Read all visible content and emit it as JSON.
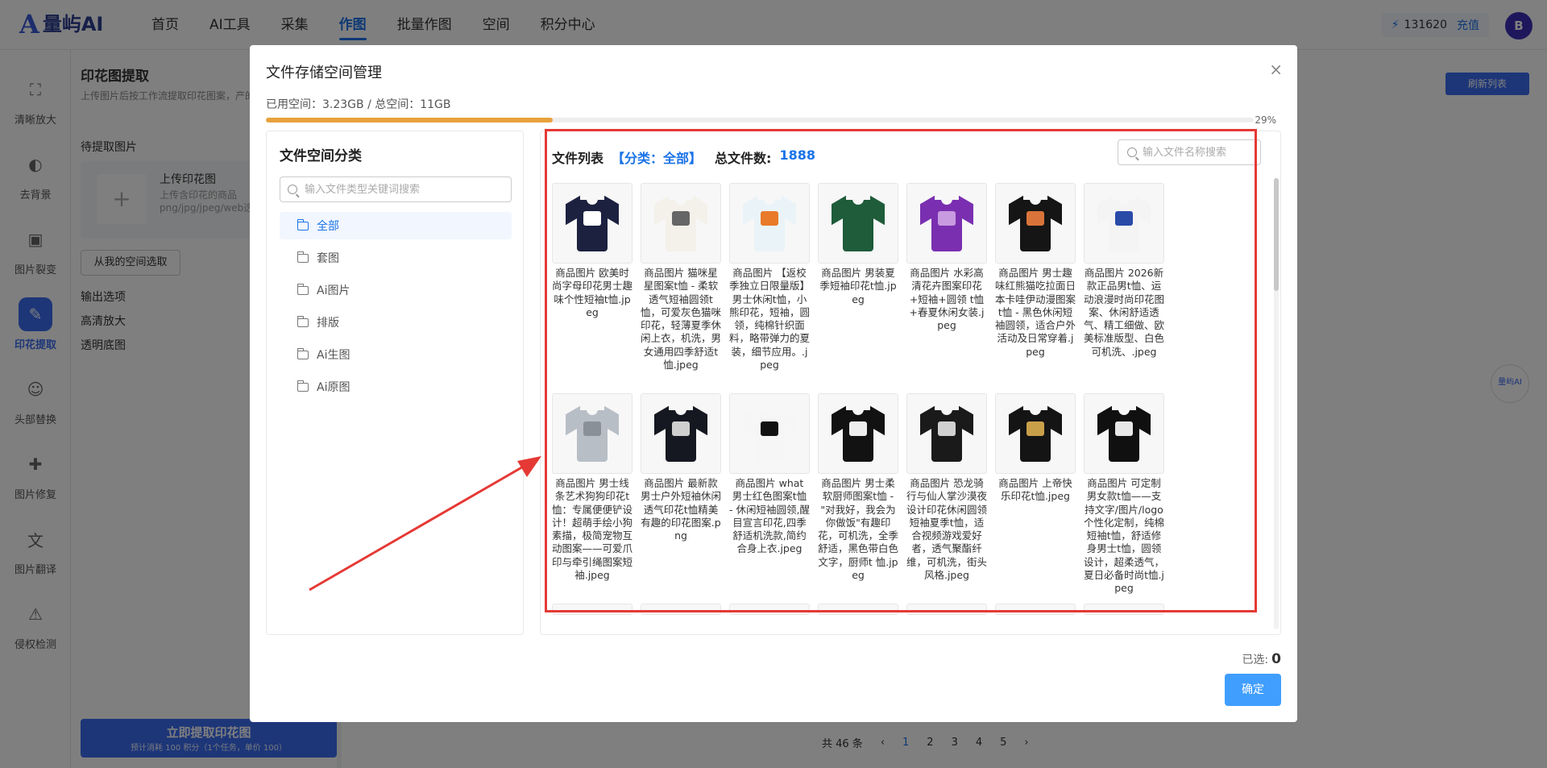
{
  "header": {
    "logo_mark": "A",
    "logo_text": "量屿AI",
    "nav": [
      "首页",
      "AI工具",
      "采集",
      "作图",
      "批量作图",
      "空间",
      "积分中心"
    ],
    "active_nav": 3,
    "credits": "131620",
    "recharge": "充值",
    "avatar": "B"
  },
  "sidebar": {
    "items": [
      {
        "label": "清晰放大",
        "icon": "image-enhance-icon"
      },
      {
        "label": "去背景",
        "icon": "remove-bg-icon"
      },
      {
        "label": "图片裂变",
        "icon": "image-split-icon"
      },
      {
        "label": "印花提取",
        "icon": "print-extract-icon",
        "active": true
      },
      {
        "label": "头部替换",
        "icon": "head-swap-icon"
      },
      {
        "label": "图片修复",
        "icon": "image-repair-icon"
      },
      {
        "label": "图片翻译",
        "icon": "image-translate-icon"
      },
      {
        "label": "侵权检测",
        "icon": "infringement-check-icon"
      }
    ]
  },
  "background": {
    "title": "印花图提取",
    "desc": "上传图片后按工作流提取印花图案，产的印花素材",
    "pending_heading": "待提取图片",
    "upload_title": "上传印花图",
    "upload_sub": "上传含印花的商品png/jpg/jpeg/web选取",
    "space_btn": "从我的空间选取",
    "output_heading": "输出选项",
    "opt1": "高清放大",
    "opt2": "透明底图",
    "extract_btn": "立即提取印花图",
    "extract_sub": "预计消耗 100 积分（1个任务，单价 100）",
    "refresh": "刷新列表",
    "pager_total": "共 46 条",
    "pages": [
      "1",
      "2",
      "3",
      "4",
      "5"
    ],
    "floater": "量屿AI"
  },
  "modal": {
    "title": "文件存储空间管理",
    "close": "×",
    "usage_text": "已用空间：3.23GB / 总空间：11GB",
    "usage_pct": 29,
    "usage_pct_label": "29%",
    "categories_title": "文件空间分类",
    "cat_search_placeholder": "输入文件类型关键词搜索",
    "categories": [
      "全部",
      "套图",
      "Ai图片",
      "排版",
      "Ai生图",
      "Ai原图"
    ],
    "active_category": 0,
    "file_list_title": "文件列表",
    "category_tag": "【分类：全部】",
    "total_label": "总文件数:",
    "total_count": "1888",
    "file_search_placeholder": "输入文件名称搜索",
    "selected_label": "已选:",
    "selected_count": "0",
    "confirm": "确定"
  },
  "files": [
    {
      "name": "商品图片 欧美时尚字母印花男士趣味个性短袖t恤.jpeg",
      "shirt": "#1c2140",
      "print": "#ffffff"
    },
    {
      "name": "商品图片 猫咪星星图案t恤 - 柔软透气短袖圆领t恤，可爱灰色猫咪印花，轻薄夏季休闲上衣，机洗，男女通用四季舒适t恤.jpeg",
      "shirt": "#f3f1ea",
      "print": "#666666"
    },
    {
      "name": "商品图片 【返校季独立日限量版】男士休闲t恤，小熊印花，短袖，圆领，纯棉针织面料，略带弹力的夏装，细节应用。.jpeg",
      "shirt": "#eaf3f8",
      "print": "#e87a2a"
    },
    {
      "name": "商品图片 男装夏季短袖印花t恤.jpeg",
      "shirt": "#1e5c3a",
      "print": "#1e5c3a"
    },
    {
      "name": "商品图片 水彩高清花卉图案印花+短袖+圆领 t恤+春夏休闲女装.jpeg",
      "shirt": "#7a2fb0",
      "print": "#c89be0"
    },
    {
      "name": "商品图片 男士趣味红熊猫吃拉面日本卡哇伊动漫图案t恤 - 黑色休闲短袖圆领，适合户外活动及日常穿着.jpeg",
      "shirt": "#151515",
      "print": "#d8743a"
    },
    {
      "name": "商品图片 2026新款正品男t恤、运动浪漫时尚印花图案、休闲舒适透气、精工细做、欧美标准版型、白色可机洗、.jpeg",
      "shirt": "#f4f4f4",
      "print": "#2a4aa8"
    },
    {
      "name": "商品图片 男士线条艺术狗狗印花t恤：专属便便铲设计！超萌手绘小狗素描，极简宠物互动图案——可爱爪印与牵引绳图案短袖.jpeg",
      "shirt": "#b8bec6",
      "print": "#8a9098"
    },
    {
      "name": "商品图片 最新款男士户外短袖休闲透气印花t恤精美有趣的印花图案.png",
      "shirt": "#151820",
      "print": "#cfcfcf"
    },
    {
      "name": "商品图片 what 男士红色图案t恤 - 休闲短袖圆领,醒目宣言印花,四季舒适机洗款,简约合身上衣.jpeg",
      "shirt": "#f6f6f6",
      "print": "#111111"
    },
    {
      "name": "商品图片 男士柔软厨师图案t恤 - \"对我好，我会为你做饭\"有趣印花，可机洗，全季舒适，黑色带白色文字，厨师t 恤.jpeg",
      "shirt": "#121212",
      "print": "#eeeeee"
    },
    {
      "name": "商品图片 恐龙骑行与仙人掌沙漠夜设计印花休闲圆领短袖夏季t恤，适合视频游戏爱好者，透气聚酯纤维，可机洗，街头风格.jpeg",
      "shirt": "#1a1a1a",
      "print": "#d0d0d0"
    },
    {
      "name": "商品图片 上帝快乐印花t恤.jpeg",
      "shirt": "#141414",
      "print": "#c9a04a"
    },
    {
      "name": "商品图片 可定制男女款t恤——支持文字/图片/logo个性化定制，纯棉短袖t恤，舒适修身男士t恤，圆领设计，超柔透气，夏日必备时尚t恤.jpeg",
      "shirt": "#101010",
      "print": "#e8e8e8"
    }
  ]
}
